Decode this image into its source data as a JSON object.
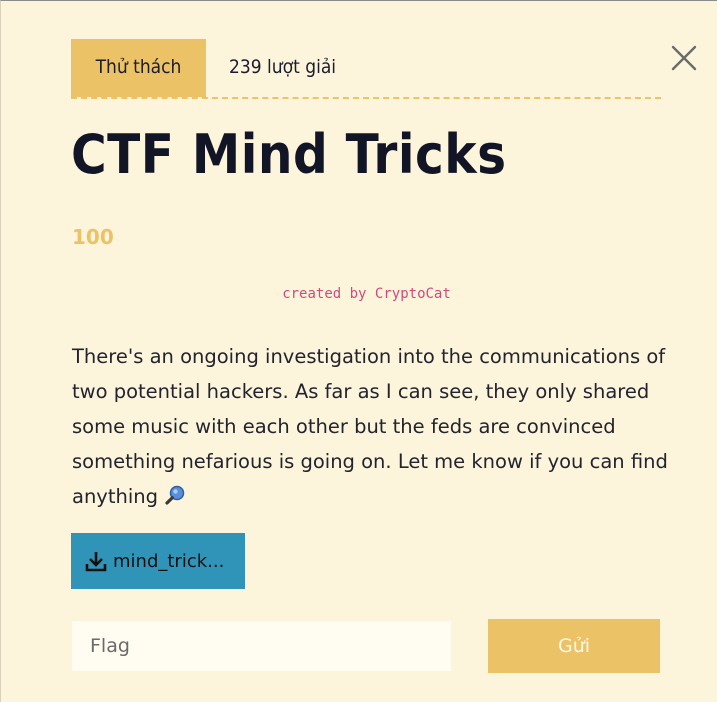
{
  "modal": {
    "close_icon": "close-icon",
    "tabs": [
      {
        "label": "Thử thách",
        "active": true
      },
      {
        "label": "239 lượt giải",
        "active": false
      }
    ],
    "title": "CTF Mind Tricks",
    "points": "100",
    "author": "created by CryptoCat",
    "description": "There's an ongoing investigation into the communications of two potential hackers. As far as I can see, they only shared some music with each other but the feds are convinced something nefarious is going on. Let me know if you can find anything",
    "description_icon": "magnifier-icon",
    "file": {
      "label": "mind_trick...",
      "icon": "download-icon"
    },
    "flag_input": {
      "placeholder": "Flag",
      "value": ""
    },
    "submit_label": "Gửi"
  },
  "colors": {
    "background": "#fcf5dc",
    "accent": "#ecc267",
    "title": "#111526",
    "author": "#d14a7a",
    "download_button": "#3094b8"
  }
}
